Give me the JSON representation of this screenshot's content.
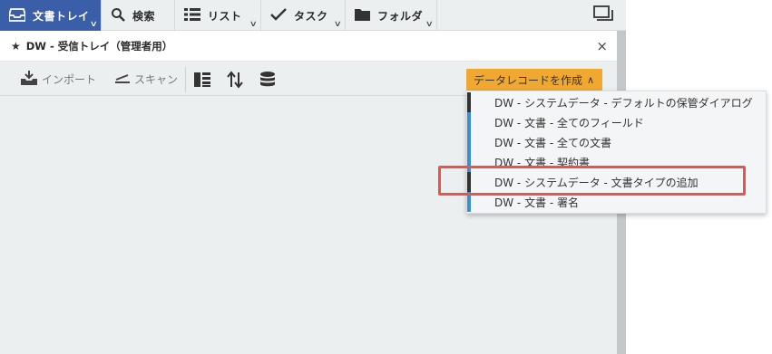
{
  "nav": {
    "tabs": [
      {
        "label": "文書トレイ",
        "icon": "inbox-tray-icon"
      },
      {
        "label": "検索",
        "icon": "search-icon"
      },
      {
        "label": "リスト",
        "icon": "list-icon"
      },
      {
        "label": "タスク",
        "icon": "check-icon"
      },
      {
        "label": "フォルダ",
        "icon": "folder-icon"
      }
    ],
    "window_icon": "window-restore-icon"
  },
  "panel": {
    "title": "DW - 受信トレイ（管理者用）",
    "close_label": "×"
  },
  "toolbar": {
    "import_label": "インポート",
    "scan_label": "スキャン",
    "create_label": "データレコードを作成",
    "create_caret": "∧"
  },
  "dropdown": {
    "items": [
      {
        "label": "DW - システムデータ - デフォルトの保管ダイアログ",
        "color": "#333333"
      },
      {
        "label": "DW - 文書 - 全てのフィールド",
        "color": "#3a8fd4"
      },
      {
        "label": "DW - 文書 - 全ての文書",
        "color": "#3a8fd4"
      },
      {
        "label": "DW - 文書 - 契約書",
        "color": "#3a8fd4"
      },
      {
        "label": "DW - システムデータ - 文書タイプの追加",
        "color": "#333333"
      },
      {
        "label": "DW - 文書 - 署名",
        "color": "#3a8fd4"
      }
    ]
  },
  "colors": {
    "active_tab": "#3b5ea8",
    "create_button": "#f0a830",
    "highlight": "#e8544a"
  }
}
